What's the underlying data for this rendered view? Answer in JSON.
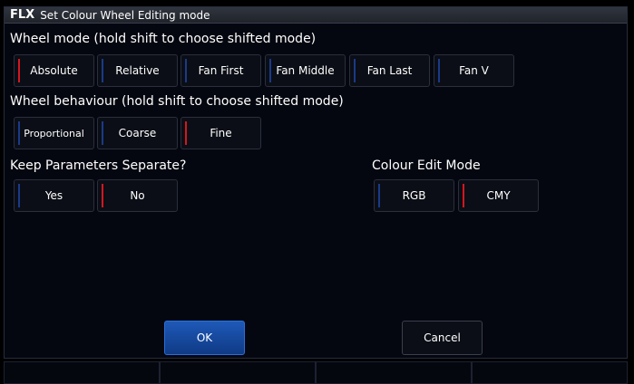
{
  "dialog": {
    "logo": "FLX",
    "title": "Set Colour Wheel Editing mode"
  },
  "wheel_mode": {
    "heading": "Wheel mode (hold shift to choose shifted mode)",
    "options": [
      {
        "label": "Absolute",
        "selected": true
      },
      {
        "label": "Relative",
        "selected": false
      },
      {
        "label": "Fan First",
        "selected": false
      },
      {
        "label": "Fan Middle",
        "selected": false
      },
      {
        "label": "Fan Last",
        "selected": false
      },
      {
        "label": "Fan V",
        "selected": false
      }
    ]
  },
  "wheel_behaviour": {
    "heading": "Wheel behaviour (hold shift to choose shifted mode)",
    "options": [
      {
        "label": "Proportional",
        "selected": false
      },
      {
        "label": "Coarse",
        "selected": false
      },
      {
        "label": "Fine",
        "selected": true
      }
    ]
  },
  "keep_parameters": {
    "heading": "Keep Parameters Separate?",
    "options": [
      {
        "label": "Yes",
        "selected": false
      },
      {
        "label": "No",
        "selected": true
      }
    ]
  },
  "colour_edit_mode": {
    "heading": "Colour Edit Mode",
    "options": [
      {
        "label": "RGB",
        "selected": false
      },
      {
        "label": "CMY",
        "selected": true
      }
    ]
  },
  "footer": {
    "ok_label": "OK",
    "cancel_label": "Cancel"
  },
  "colors": {
    "selected_indicator": "#d3171f",
    "unselected_indicator": "#1a3a88",
    "ok_button": "#1e59b8"
  }
}
